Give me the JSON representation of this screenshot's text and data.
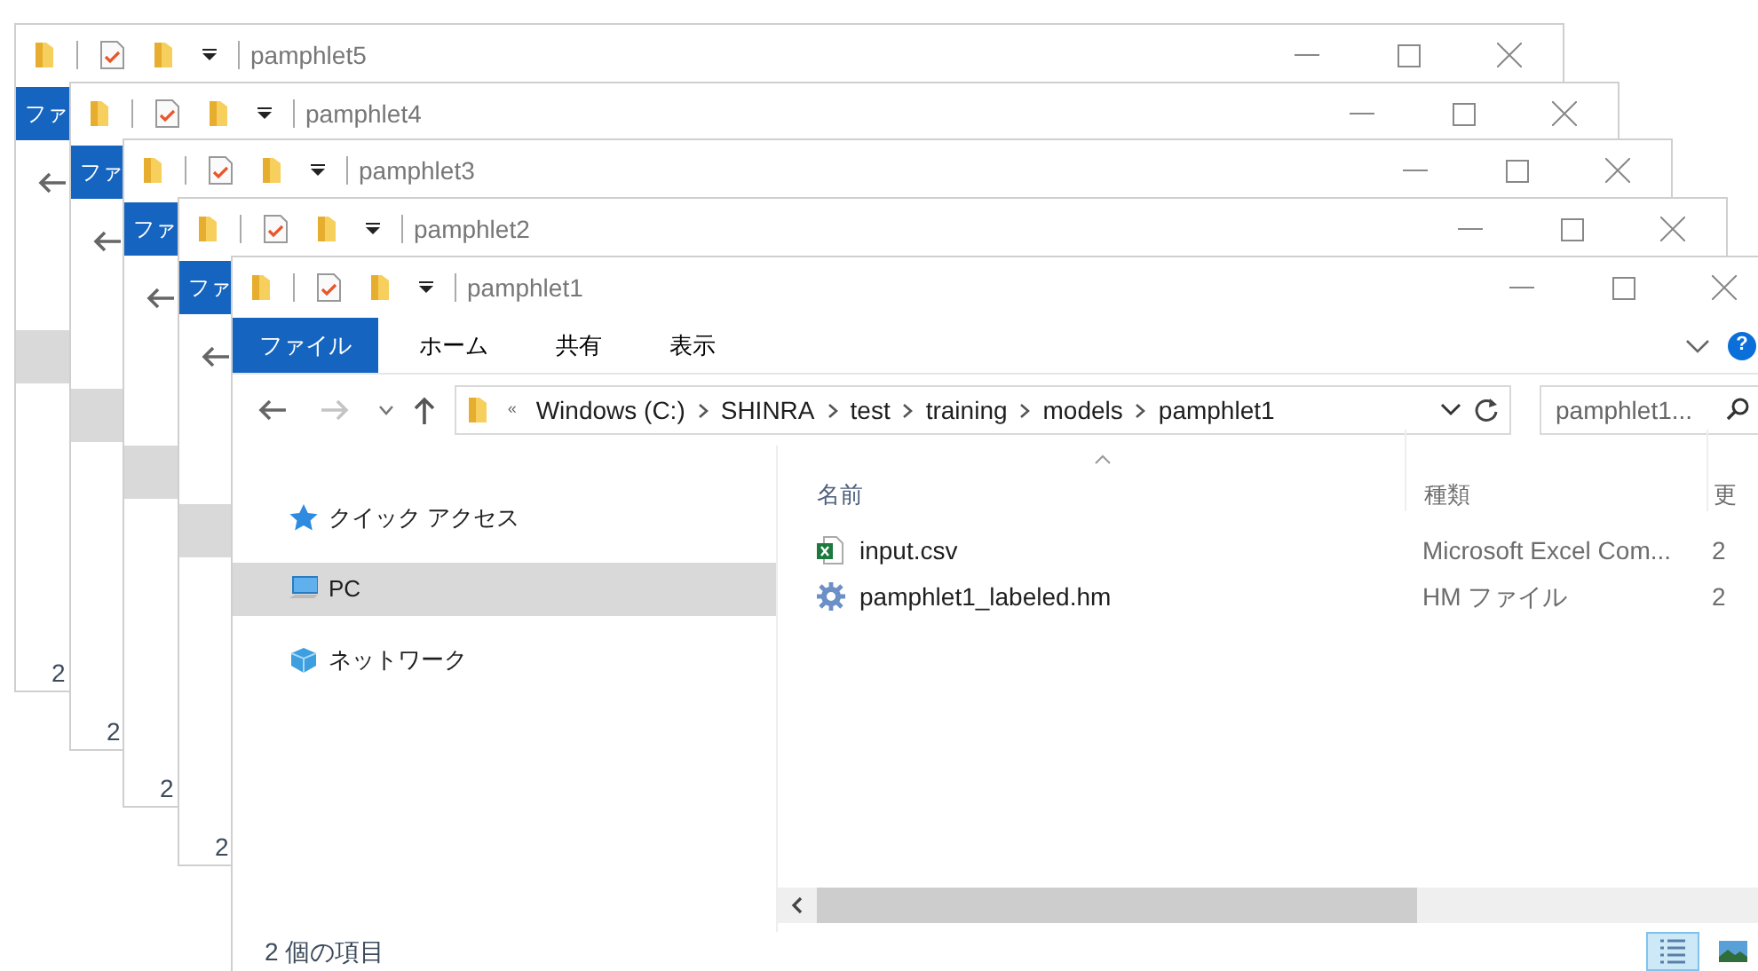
{
  "background_windows": [
    {
      "title": "pamphlet5",
      "ribbon_tab": "ファ",
      "status": "2"
    },
    {
      "title": "pamphlet4",
      "ribbon_tab": "ファ",
      "status": "2"
    },
    {
      "title": "pamphlet3",
      "ribbon_tab": "ファ",
      "status": "2"
    },
    {
      "title": "pamphlet2",
      "ribbon_tab": "ファ",
      "status": "2"
    }
  ],
  "main_window": {
    "title": "pamphlet1",
    "ribbon_tabs": [
      {
        "label": "ファイル",
        "selected": true
      },
      {
        "label": "ホーム",
        "selected": false
      },
      {
        "label": "共有",
        "selected": false
      },
      {
        "label": "表示",
        "selected": false
      }
    ],
    "help": "?",
    "address": {
      "overflow": "«",
      "path": [
        "Windows (C:)",
        "SHINRA",
        "test",
        "training",
        "models",
        "pamphlet1"
      ]
    },
    "search": {
      "placeholder": "pamphlet1..."
    },
    "nav": [
      {
        "label": "クイック アクセス",
        "kind": "quick",
        "selected": false
      },
      {
        "label": "PC",
        "kind": "pc",
        "selected": true
      },
      {
        "label": "ネットワーク",
        "kind": "network",
        "selected": false
      }
    ],
    "columns": [
      "名前",
      "種類",
      "更"
    ],
    "files": [
      {
        "name": "input.csv",
        "kind": "csv",
        "type": "Microsoft Excel Com...",
        "column_3": "2"
      },
      {
        "name": "pamphlet1_labeled.hm",
        "kind": "hm",
        "type": "HM ファイル",
        "column_3": "2"
      }
    ],
    "status": "2 個の項目",
    "views": [
      {
        "kind": "details",
        "selected": true
      },
      {
        "kind": "large",
        "selected": false
      }
    ]
  }
}
